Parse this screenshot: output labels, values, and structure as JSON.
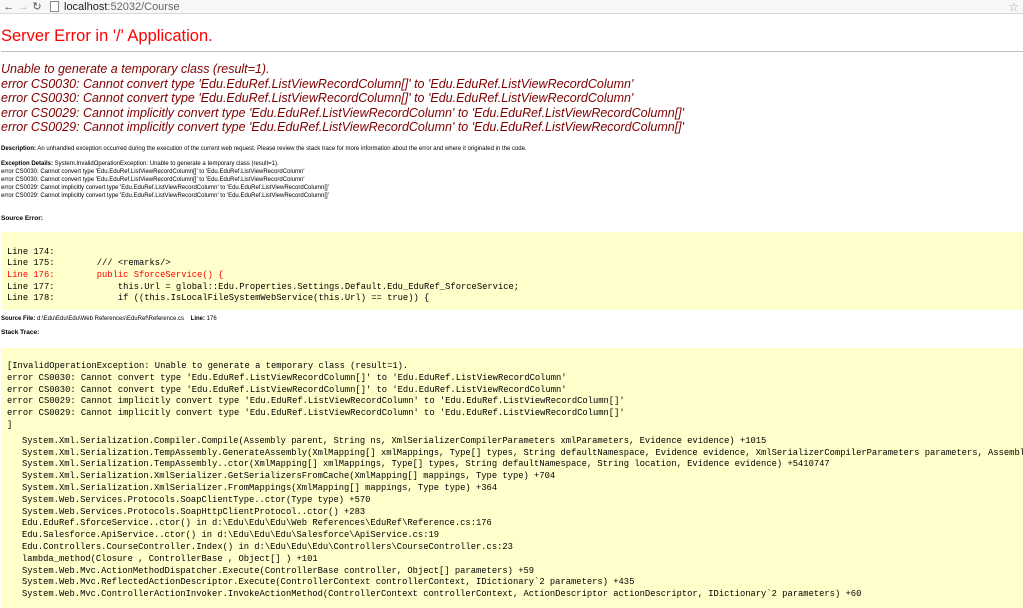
{
  "browser": {
    "url_host": "localhost",
    "url_port_path": ":52032/Course"
  },
  "page": {
    "title": "Server Error in '/' Application.",
    "errors": [
      "Unable to generate a temporary class (result=1).",
      "error CS0030: Cannot convert type 'Edu.EduRef.ListViewRecordColumn[]' to 'Edu.EduRef.ListViewRecordColumn'",
      "error CS0030: Cannot convert type 'Edu.EduRef.ListViewRecordColumn[]' to 'Edu.EduRef.ListViewRecordColumn'",
      "error CS0029: Cannot implicitly convert type 'Edu.EduRef.ListViewRecordColumn' to 'Edu.EduRef.ListViewRecordColumn[]'",
      "error CS0029: Cannot implicitly convert type 'Edu.EduRef.ListViewRecordColumn' to 'Edu.EduRef.ListViewRecordColumn[]'"
    ],
    "description_label": "Description:",
    "description_text": " An unhandled exception occurred during the execution of the current web request. Please review the stack trace for more information about the error and where it originated in the code.",
    "exception_label": "Exception Details:",
    "exception_text": " System.InvalidOperationException: Unable to generate a temporary class (result=1).",
    "exception_lines": [
      "error CS0030: Cannot convert type 'Edu.EduRef.ListViewRecordColumn[]' to 'Edu.EduRef.ListViewRecordColumn'",
      "error CS0030: Cannot convert type 'Edu.EduRef.ListViewRecordColumn[]' to 'Edu.EduRef.ListViewRecordColumn'",
      "error CS0029: Cannot implicitly convert type 'Edu.EduRef.ListViewRecordColumn' to 'Edu.EduRef.ListViewRecordColumn[]'",
      "error CS0029: Cannot implicitly convert type 'Edu.EduRef.ListViewRecordColumn' to 'Edu.EduRef.ListViewRecordColumn[]'"
    ],
    "source_error_label": "Source Error:",
    "source_lines": [
      {
        "text": "Line 174:",
        "highlight": false
      },
      {
        "text": "Line 175:        /// <remarks/>",
        "highlight": false
      },
      {
        "text": "Line 176:        public SforceService() {",
        "highlight": true
      },
      {
        "text": "Line 177:            this.Url = global::Edu.Properties.Settings.Default.Edu_EduRef_SforceService;",
        "highlight": false
      },
      {
        "text": "Line 178:            if ((this.IsLocalFileSystemWebService(this.Url) == true)) {",
        "highlight": false
      }
    ],
    "source_file_label": "Source File:",
    "source_file_path": " d:\\Edu\\Edu\\Edu\\Web References\\EduRef\\Reference.cs",
    "line_label": "Line:",
    "line_number": " 176",
    "stack_label": "Stack Trace:",
    "stack_header": [
      "[InvalidOperationException: Unable to generate a temporary class (result=1).",
      "error CS0030: Cannot convert type 'Edu.EduRef.ListViewRecordColumn[]' to 'Edu.EduRef.ListViewRecordColumn'",
      "error CS0030: Cannot convert type 'Edu.EduRef.ListViewRecordColumn[]' to 'Edu.EduRef.ListViewRecordColumn'",
      "error CS0029: Cannot implicitly convert type 'Edu.EduRef.ListViewRecordColumn' to 'Edu.EduRef.ListViewRecordColumn[]'",
      "error CS0029: Cannot implicitly convert type 'Edu.EduRef.ListViewRecordColumn' to 'Edu.EduRef.ListViewRecordColumn[]'",
      "]"
    ],
    "stack_frames": [
      "System.Xml.Serialization.Compiler.Compile(Assembly parent, String ns, XmlSerializerCompilerParameters xmlParameters, Evidence evidence) +1015",
      "System.Xml.Serialization.TempAssembly.GenerateAssembly(XmlMapping[] xmlMappings, Type[] types, String defaultNamespace, Evidence evidence, XmlSerializerCompilerParameters parameters, Assembly assemb",
      "System.Xml.Serialization.TempAssembly..ctor(XmlMapping[] xmlMappings, Type[] types, String defaultNamespace, String location, Evidence evidence) +5410747",
      "System.Xml.Serialization.XmlSerializer.GetSerializersFromCache(XmlMapping[] mappings, Type type) +704",
      "System.Xml.Serialization.XmlSerializer.FromMappings(XmlMapping[] mappings, Type type) +364",
      "System.Web.Services.Protocols.SoapClientType..ctor(Type type) +570",
      "System.Web.Services.Protocols.SoapHttpClientProtocol..ctor() +283",
      "Edu.EduRef.SforceService..ctor() in d:\\Edu\\Edu\\Edu\\Web References\\EduRef\\Reference.cs:176",
      "Edu.Salesforce.ApiService..ctor() in d:\\Edu\\Edu\\Edu\\Salesforce\\ApiService.cs:19",
      "Edu.Controllers.CourseController.Index() in d:\\Edu\\Edu\\Edu\\Controllers\\CourseController.cs:23",
      "lambda_method(Closure , ControllerBase , Object[] ) +101",
      "System.Web.Mvc.ActionMethodDispatcher.Execute(ControllerBase controller, Object[] parameters) +59",
      "System.Web.Mvc.ReflectedActionDescriptor.Execute(ControllerContext controllerContext, IDictionary`2 parameters) +435",
      "System.Web.Mvc.ControllerActionInvoker.InvokeActionMethod(ControllerContext controllerContext, ActionDescriptor actionDescriptor, IDictionary`2 parameters) +60"
    ]
  },
  "colors": {
    "title": "#ff0000",
    "error_heading": "#800000",
    "code_background": "#ffffcc",
    "highlight_line": "#ff0000"
  }
}
